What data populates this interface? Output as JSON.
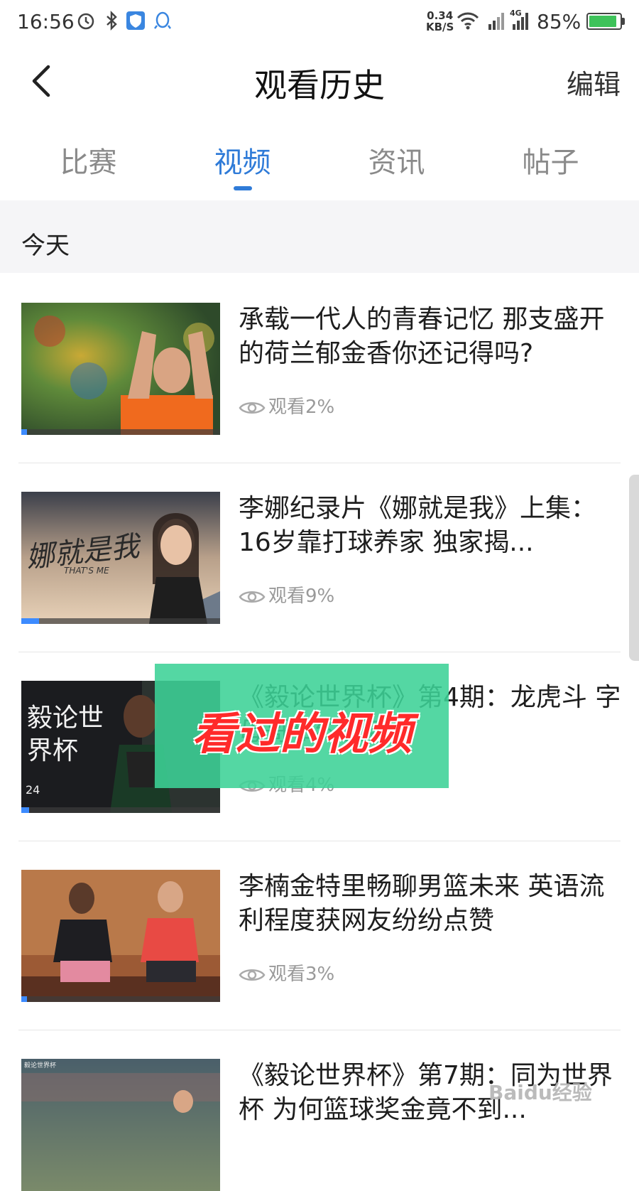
{
  "status_bar": {
    "time": "16:56",
    "speed_value": "0.34",
    "speed_unit": "KB/S",
    "network": "4G",
    "battery_pct": "85%",
    "icons": [
      "alarm-icon",
      "bluetooth-icon",
      "shield-icon",
      "qq-icon",
      "wifi-icon",
      "signal-icon"
    ]
  },
  "header": {
    "title": "观看历史",
    "edit_label": "编辑"
  },
  "tabs": [
    {
      "label": "比赛",
      "active": false
    },
    {
      "label": "视频",
      "active": true
    },
    {
      "label": "资讯",
      "active": false
    },
    {
      "label": "帖子",
      "active": false
    }
  ],
  "section": {
    "label": "今天"
  },
  "items": [
    {
      "title": "承载一代人的青春记忆 那支盛开的荷兰郁金香你还记得吗?",
      "watched": "观看2%",
      "progress": 0.02
    },
    {
      "title": "李娜纪录片《娜就是我》上集：16岁靠打球养家 独家揭...",
      "watched": "观看9%",
      "progress": 0.09
    },
    {
      "title": "《毅论世界杯》第4期：龙虎斗 字母哥和约基奇...",
      "watched": "观看4%",
      "progress": 0.04
    },
    {
      "title": "李楠金特里畅聊男篮未来 英语流利程度获网友纷纷点赞",
      "watched": "观看3%",
      "progress": 0.03
    },
    {
      "title": "《毅论世界杯》第7期：同为世界杯 为何篮球奖金竟不到...",
      "watched": "",
      "progress": 0.0
    }
  ],
  "thumbnails": {
    "t2_text": "娜就是我",
    "t2_sub": "THAT'S ME",
    "t3_text": "毅论世界杯",
    "t3_badge": "24",
    "t5_badge": "毅论世界杯"
  },
  "overlay": {
    "text": "看过的视频"
  },
  "watermark": {
    "text": "Baidu经验"
  },
  "colors": {
    "accent": "#2f7bd8",
    "overlay": "#3cd296",
    "overlay_text": "#ff2a2a"
  }
}
